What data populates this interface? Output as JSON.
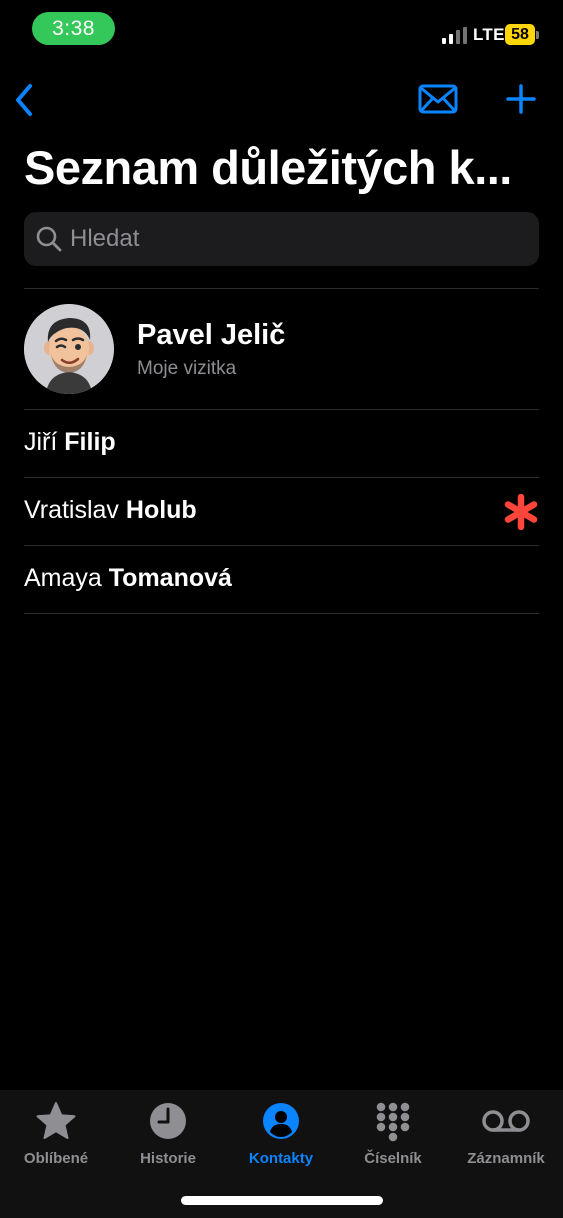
{
  "status_bar": {
    "time": "3:38",
    "network": "LTE",
    "battery": "58",
    "time_pill_color": "#34c759",
    "battery_color": "#ffd60a"
  },
  "nav": {
    "back_icon": "chevron-left-icon",
    "mail_icon": "envelope-icon",
    "add_icon": "plus-icon",
    "accent_color": "#0a84ff"
  },
  "page": {
    "title": "Seznam důležitých k..."
  },
  "search": {
    "placeholder": "Hledat",
    "icon": "search-icon"
  },
  "my_card": {
    "name": "Pavel Jelič",
    "subtitle": "Moje vizitka"
  },
  "contacts": [
    {
      "first": "Jiří",
      "last": "Filip",
      "emergency": false
    },
    {
      "first": "Vratislav",
      "last": "Holub",
      "emergency": true
    },
    {
      "first": "Amaya",
      "last": "Tomanová",
      "emergency": false
    }
  ],
  "emergency_color": "#ff453a",
  "tabs": [
    {
      "label": "Oblíbené",
      "icon": "star-icon",
      "active": false
    },
    {
      "label": "Historie",
      "icon": "clock-icon",
      "active": false
    },
    {
      "label": "Kontakty",
      "icon": "person-circle-icon",
      "active": true
    },
    {
      "label": "Číselník",
      "icon": "keypad-icon",
      "active": false
    },
    {
      "label": "Záznamník",
      "icon": "voicemail-icon",
      "active": false
    }
  ]
}
